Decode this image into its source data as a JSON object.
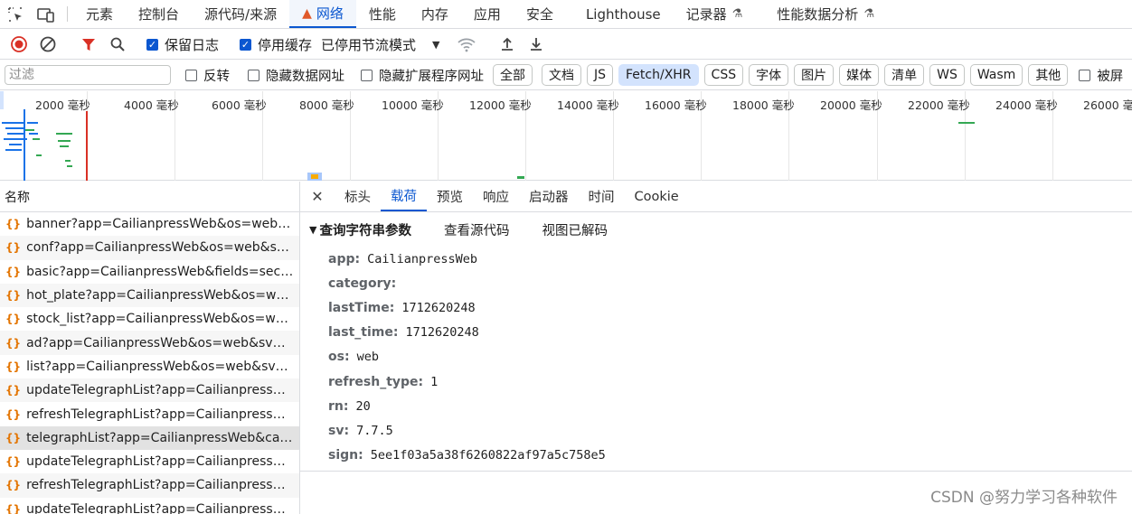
{
  "top_tabs": [
    "元素",
    "控制台",
    "源代码/来源",
    "网络",
    "性能",
    "内存",
    "应用",
    "安全",
    "Lighthouse",
    "记录器",
    "性能数据分析"
  ],
  "toolbar": {
    "preserve_log": "保留日志",
    "disable_cache": "停用缓存",
    "throttle": "已停用节流模式"
  },
  "filter": {
    "placeholder": "过滤",
    "invert": "反转",
    "hide_data_urls": "隐藏数据网址",
    "hide_extension_urls": "隐藏扩展程序网址",
    "types": [
      "全部",
      "文档",
      "JS",
      "Fetch/XHR",
      "CSS",
      "字体",
      "图片",
      "媒体",
      "清单",
      "WS",
      "Wasm",
      "其他"
    ],
    "blocked": "被屏"
  },
  "timeline": {
    "ticks": [
      "2000 毫秒",
      "4000 毫秒",
      "6000 毫秒",
      "8000 毫秒",
      "10000 毫秒",
      "12000 毫秒",
      "14000 毫秒",
      "16000 毫秒",
      "18000 毫秒",
      "20000 毫秒",
      "22000 毫秒",
      "24000 毫秒",
      "26000 毫秒"
    ]
  },
  "names_header": "名称",
  "requests": [
    "banner?app=CailianpressWeb&os=web&s...",
    "conf?app=CailianpressWeb&os=web&sv=...",
    "basic?app=CailianpressWeb&fields=secu_n...",
    "hot_plate?app=CailianpressWeb&os=web...",
    "stock_list?app=CailianpressWeb&os=web...",
    "ad?app=CailianpressWeb&os=web&sv=7....",
    "list?app=CailianpressWeb&os=web&sv=7....",
    "updateTelegraphList?app=CailianpressWeb...",
    "refreshTelegraphList?app=CailianpressWeb...",
    "telegraphList?app=CailianpressWeb&categ...",
    "updateTelegraphList?app=CailianpressWeb...",
    "refreshTelegraphList?app=CailianpressWeb...",
    "updateTelegraphList?app=CailianpressWeb..."
  ],
  "detail_tabs": [
    "标头",
    "载荷",
    "预览",
    "响应",
    "启动器",
    "时间",
    "Cookie"
  ],
  "payload": {
    "section_title": "查询字符串参数",
    "view_source": "查看源代码",
    "view_decoded": "视图已解码",
    "params": [
      {
        "key": "app:",
        "value": "CailianpressWeb"
      },
      {
        "key": "category:",
        "value": ""
      },
      {
        "key": "lastTime:",
        "value": "1712620248"
      },
      {
        "key": "last_time:",
        "value": "1712620248"
      },
      {
        "key": "os:",
        "value": "web"
      },
      {
        "key": "refresh_type:",
        "value": "1"
      },
      {
        "key": "rn:",
        "value": "20"
      },
      {
        "key": "sv:",
        "value": "7.7.5"
      },
      {
        "key": "sign:",
        "value": "5ee1f03a5a38f6260822af97a5c758e5"
      }
    ]
  },
  "watermark": "CSDN @努力学习各种软件"
}
